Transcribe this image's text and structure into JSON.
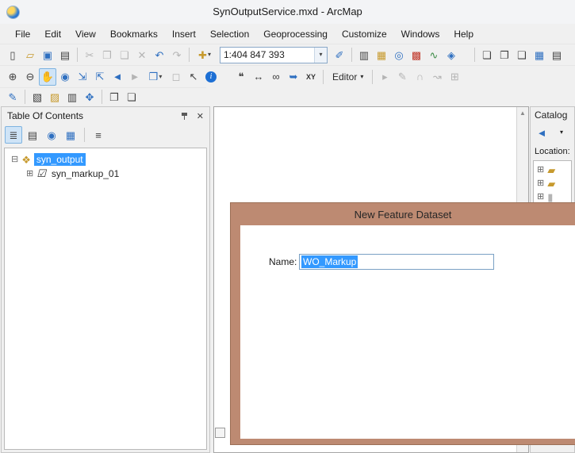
{
  "colors": {
    "selection": "#3399ff",
    "dialog_tan": "#bd8a72"
  },
  "titlebar": {
    "title": "SynOutputService.mxd - ArcMap"
  },
  "menubar": {
    "items": [
      "File",
      "Edit",
      "View",
      "Bookmarks",
      "Insert",
      "Selection",
      "Geoprocessing",
      "Customize",
      "Windows",
      "Help"
    ]
  },
  "standard_toolbar": {
    "scale_value": "1:404 847 393"
  },
  "tools_toolbar": {
    "editor_label": "Editor"
  },
  "toc": {
    "title": "Table Of Contents",
    "layers": [
      {
        "label": "syn_output",
        "selected": true
      },
      {
        "label": "syn_markup_01",
        "checked": true
      }
    ]
  },
  "catalog": {
    "title": "Catalog",
    "location_label": "Location:"
  },
  "dialog": {
    "title": "New Feature Dataset",
    "name_label": "Name:",
    "name_value": "WO_Markup"
  },
  "icons": {
    "new_document": "▯",
    "open_folder": "▱",
    "save": "▣",
    "print": "▤",
    "cut": "✂",
    "copy": "❐",
    "paste": "❏",
    "delete": "✕",
    "undo": "↶",
    "redo": "↷",
    "add_data": "✚",
    "dropdown": "▾",
    "editor_toolbar": "✐",
    "toc_window": "▥",
    "catalog_window": "▦",
    "search_window": "◎",
    "arctoolbox": "▩",
    "python_window": "∿",
    "modelbuilder": "◈",
    "overview_window": "❏",
    "magnifier_window": "❐",
    "viewer_window": "❑",
    "dataframe_grid": "▦",
    "layout_grid": "▤",
    "zoom_in": "⊕",
    "zoom_out": "⊖",
    "pan": "✋",
    "full_extent": "◉",
    "fixed_zoom_in": "⇲",
    "fixed_zoom_out": "⇱",
    "back": "◄",
    "forward": "►",
    "select_features": "❒",
    "clear_selection": "◻",
    "select_elements": "↖",
    "identify": "i",
    "html_popup": "❝",
    "measure": "↔",
    "find": "∞",
    "find_route": "➥",
    "go_to_xy": "XY",
    "edit_arrow": "▸",
    "sketch_tool": "✎",
    "arc_tool": "∩",
    "trace_tool": "↝",
    "create_features": "⊞",
    "r3_1": "✎",
    "r3_2": "▧",
    "r3_3": "▨",
    "r3_4": "▥",
    "r3_5": "✥",
    "r3_6": "❐",
    "r3_7": "❏",
    "toc_drawing_order": "≣",
    "toc_source": "▤",
    "toc_visibility": "◉",
    "toc_selection": "▦",
    "toc_options": "≡",
    "catalog_back": "◄",
    "catalog_drop": "▾",
    "catalog_extra": "▤",
    "tree_collapse": "⊟",
    "tree_expand": "⊞",
    "checkbox_checked": "☑",
    "group_layer": "❖",
    "folder": "▰",
    "geodatabase": "▮",
    "scroll_up": "▲",
    "close": "✕"
  }
}
